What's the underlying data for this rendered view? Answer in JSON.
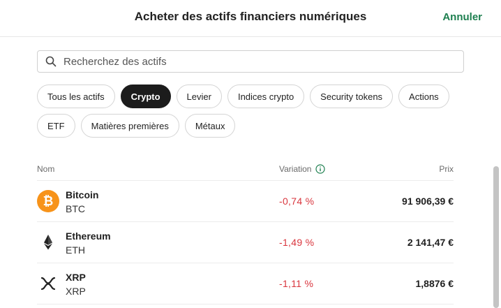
{
  "header": {
    "title": "Acheter des actifs financiers numériques",
    "cancel_label": "Annuler"
  },
  "search": {
    "placeholder": "Recherchez des actifs",
    "value": "",
    "icon": "search-icon"
  },
  "filters": {
    "selected": "Crypto",
    "row1": [
      "Tous les actifs",
      "Crypto",
      "Levier",
      "Indices crypto",
      "Security tokens",
      "Actions"
    ],
    "row2": [
      "ETF",
      "Matières premières",
      "Métaux"
    ]
  },
  "table": {
    "headers": {
      "name": "Nom",
      "change": "Variation",
      "price": "Prix"
    },
    "rows": [
      {
        "name": "Bitcoin",
        "ticker": "BTC",
        "change": "-0,74 %",
        "price": "91 906,39 €",
        "icon": "bitcoin-icon"
      },
      {
        "name": "Ethereum",
        "ticker": "ETH",
        "change": "-1,49 %",
        "price": "2 141,47 €",
        "icon": "ethereum-icon"
      },
      {
        "name": "XRP",
        "ticker": "XRP",
        "change": "-1,11 %",
        "price": "1,8876 €",
        "icon": "xrp-icon"
      }
    ]
  },
  "colors": {
    "accent": "#1d7f4f",
    "negative": "#d9363e",
    "active_chip": "#1c1c1c",
    "bitcoin": "#f7931a"
  }
}
